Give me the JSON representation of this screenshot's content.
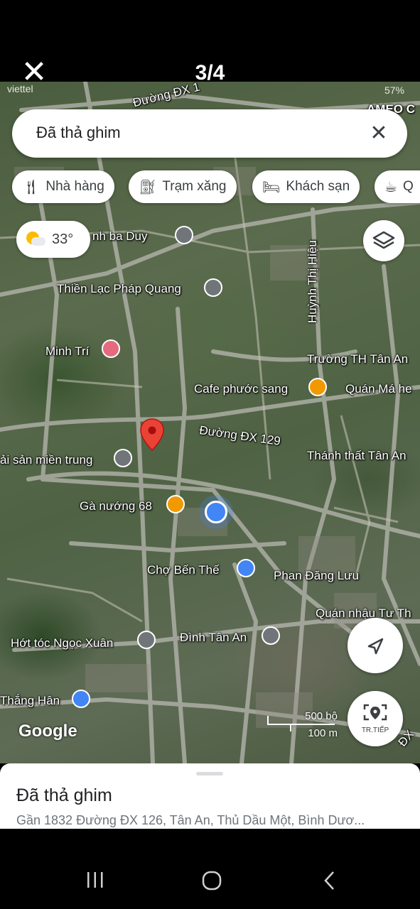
{
  "viewer": {
    "pager": "3/4"
  },
  "status_bar": {
    "left": "viettel",
    "right": "57%"
  },
  "search": {
    "value": "Đã thả ghim"
  },
  "chips": [
    {
      "icon": "restaurant-icon",
      "label": "Nhà hàng"
    },
    {
      "icon": "gas-station-icon",
      "label": "Trạm xăng"
    },
    {
      "icon": "hotel-icon",
      "label": "Khách sạn"
    },
    {
      "icon": "coffee-icon",
      "label": "Q"
    }
  ],
  "weather": {
    "temp": "33°"
  },
  "map_labels": {
    "road_top": "Đường ĐX 1",
    "ameo": "AMEO C",
    "ba_duy": "nh ba Duy",
    "thien_lac": "Thiền Lạc Pháp Quang",
    "huynh_thi_hieu": "Huỳnh Thị Hiệu",
    "minh_tri": "Minh Trí",
    "truong_th": "Trường TH Tân An",
    "cafe": "Cafe phước sang",
    "quan_ma": "Quán Má he",
    "duong_dx129": "Đường ĐX 129",
    "thanh_that": "Thánh thất Tân An",
    "hai_san": "ải sản miền trung",
    "ga_nuong": "Gà nướng 68",
    "cho_ben_the": "Chợ Bến Thế",
    "phan_dang_luu": "Phan Đăng Lưu",
    "quan_nhau": "Quán nhậu Tư Th",
    "hot_toc": "Hớt tóc Ngọc Xuân",
    "dinh_tan_an": "Đình Tân An",
    "thang_han": "Thắng Hân",
    "dx_right": "ĐX"
  },
  "google_logo": "Google",
  "scale": {
    "imperial": "500 bộ",
    "metric": "100 m"
  },
  "next_button": {
    "label": "TR.TIẾP"
  },
  "sheet": {
    "title": "Đã thả ghim",
    "address": "Gần 1832 Đường ĐX 126, Tân An, Thủ Dầu Một, Bình Dươ..."
  },
  "colors": {
    "red_pin": "#ea4335",
    "blue_dot": "#4285f4",
    "orange_poi": "#f29900",
    "blue_poi": "#4285f4",
    "gray_poi": "#70757a",
    "pink_poi": "#e56a7e"
  }
}
